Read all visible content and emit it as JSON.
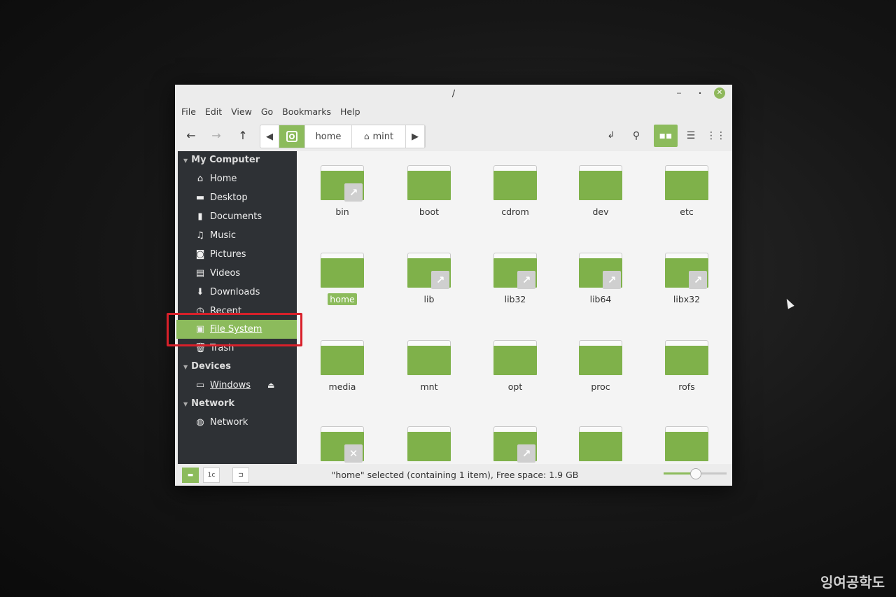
{
  "window": {
    "title": "/"
  },
  "menu": [
    "File",
    "Edit",
    "View",
    "Go",
    "Bookmarks",
    "Help"
  ],
  "pathbar": {
    "home": "home",
    "mint": "mint"
  },
  "sidebar": {
    "my_computer": {
      "header": "My Computer",
      "items": [
        {
          "label": "Home",
          "icon": "home-icon"
        },
        {
          "label": "Desktop",
          "icon": "desktop-icon"
        },
        {
          "label": "Documents",
          "icon": "document-icon"
        },
        {
          "label": "Music",
          "icon": "music-icon"
        },
        {
          "label": "Pictures",
          "icon": "camera-icon"
        },
        {
          "label": "Videos",
          "icon": "film-icon"
        },
        {
          "label": "Downloads",
          "icon": "download-icon"
        },
        {
          "label": "Recent",
          "icon": "clock-icon"
        },
        {
          "label": "File System",
          "icon": "drive-icon"
        },
        {
          "label": "Trash",
          "icon": "trash-icon"
        }
      ]
    },
    "devices": {
      "header": "Devices",
      "items": [
        {
          "label": "Windows",
          "icon": "drive-icon"
        }
      ]
    },
    "network": {
      "header": "Network",
      "items": [
        {
          "label": "Network",
          "icon": "globe-icon"
        }
      ]
    }
  },
  "files": [
    {
      "name": "bin",
      "link": true
    },
    {
      "name": "boot"
    },
    {
      "name": "cdrom"
    },
    {
      "name": "dev"
    },
    {
      "name": "etc"
    },
    {
      "name": "home",
      "selected": true
    },
    {
      "name": "lib",
      "link": true
    },
    {
      "name": "lib32",
      "link": true
    },
    {
      "name": "lib64",
      "link": true
    },
    {
      "name": "libx32",
      "link": true
    },
    {
      "name": "media"
    },
    {
      "name": "mnt"
    },
    {
      "name": "opt"
    },
    {
      "name": "proc"
    },
    {
      "name": "rofs"
    },
    {
      "name": "",
      "locked": true
    },
    {
      "name": ""
    },
    {
      "name": "",
      "link": true
    },
    {
      "name": ""
    },
    {
      "name": ""
    }
  ],
  "status": {
    "text": "\"home\" selected (containing 1 item), Free space: 1.9 GB",
    "zoom_fraction": 0.5
  },
  "accent": "#8cbb5c",
  "watermark": "잉여공학도"
}
